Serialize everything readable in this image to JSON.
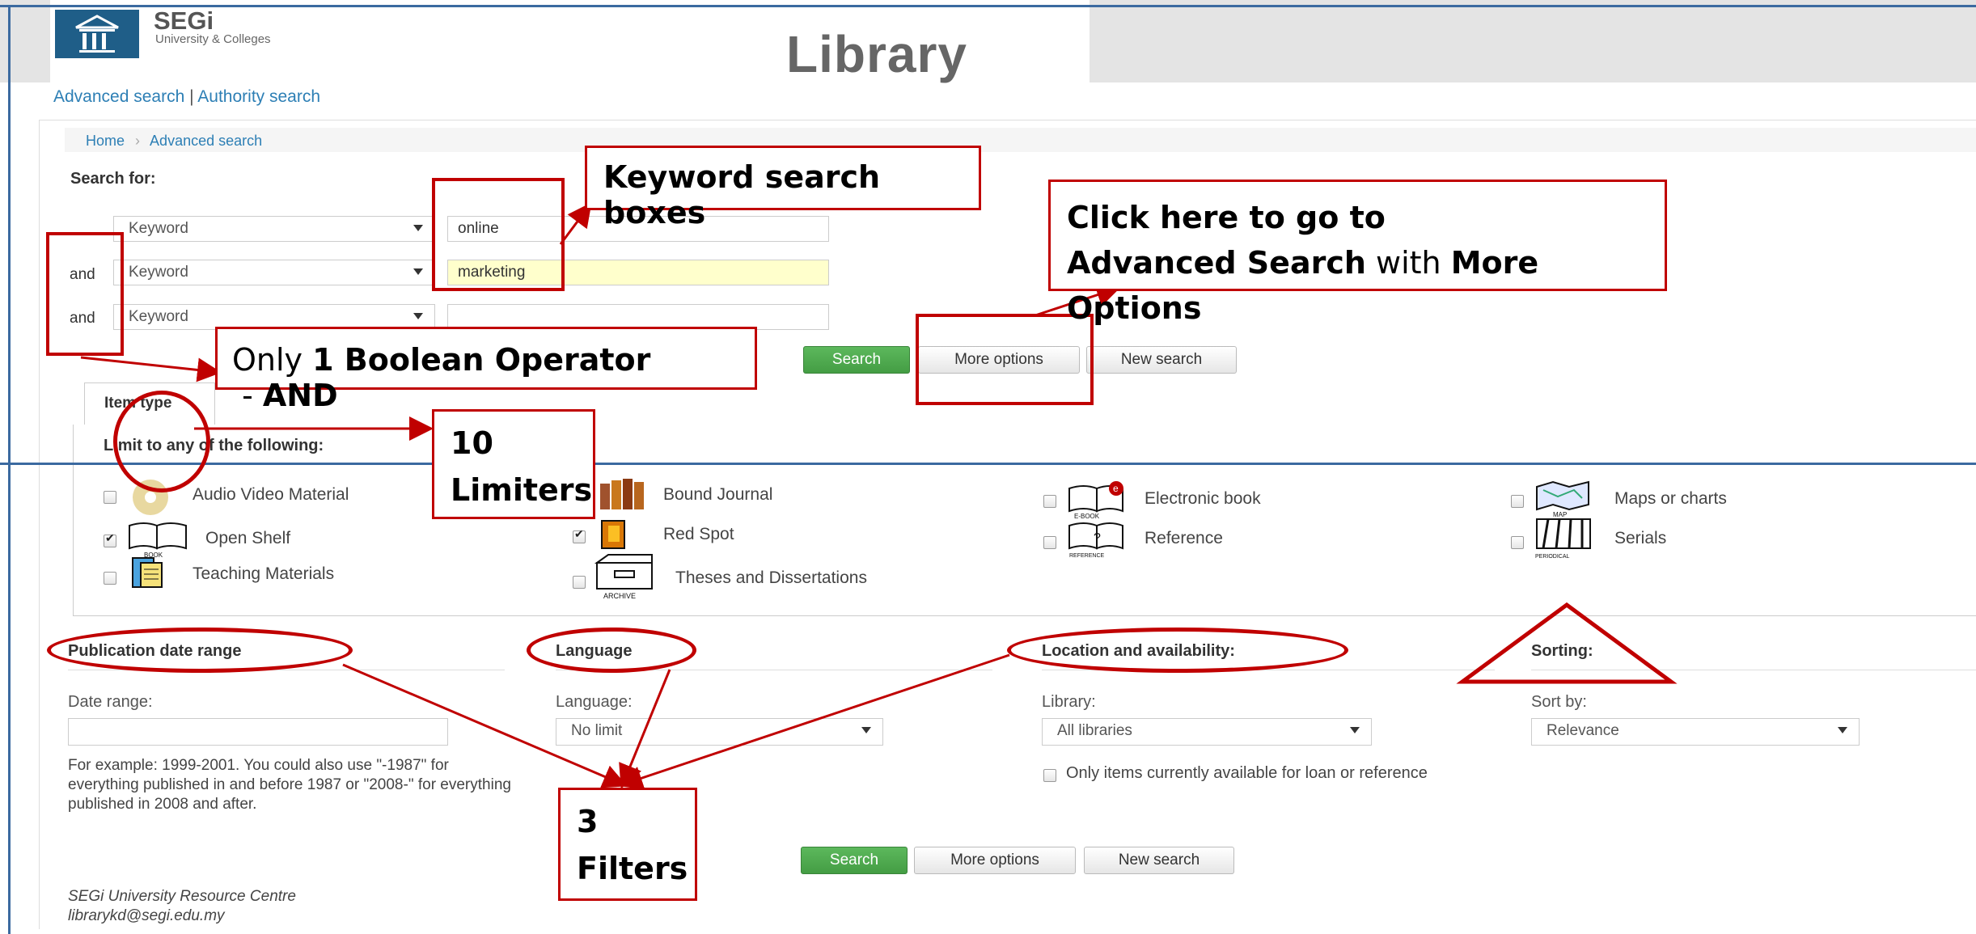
{
  "header": {
    "logo_brand": "SEGi",
    "logo_sub": "University & Colleges",
    "library_title": "Library"
  },
  "top_links": {
    "advanced_search": "Advanced search",
    "separator": "|",
    "authority_search": "Authority search"
  },
  "breadcrumb": {
    "home": "Home",
    "separator": "›",
    "current": "Advanced search"
  },
  "search": {
    "heading": "Search for:",
    "rows": [
      {
        "operator": "",
        "index": "Keyword",
        "value": "online"
      },
      {
        "operator": "and",
        "index": "Keyword",
        "value": "marketing"
      },
      {
        "operator": "and",
        "index": "Keyword",
        "value": ""
      }
    ],
    "buttons": {
      "search": "Search",
      "more_options": "More options",
      "new_search": "New search"
    }
  },
  "item_type": {
    "tab_label": "Item type",
    "limit_label": "Limit to any of the following:",
    "items": [
      {
        "label": "Audio Video Material",
        "checked": false,
        "icon": "audio-video-icon"
      },
      {
        "label": "Bound Journal",
        "checked": false,
        "icon": "bound-journal-icon"
      },
      {
        "label": "Electronic book",
        "checked": false,
        "icon": "ebook-icon",
        "caption": "E-BOOK"
      },
      {
        "label": "Maps or charts",
        "checked": false,
        "icon": "map-icon",
        "caption": "MAP"
      },
      {
        "label": "Open Shelf",
        "checked": true,
        "icon": "book-icon",
        "caption": "BOOK"
      },
      {
        "label": "Red Spot",
        "checked": true,
        "icon": "red-spot-icon"
      },
      {
        "label": "Reference",
        "checked": false,
        "icon": "reference-icon",
        "caption": "REFERENCE"
      },
      {
        "label": "Serials",
        "checked": false,
        "icon": "periodical-icon",
        "caption": "PERIODICAL"
      },
      {
        "label": "Teaching Materials",
        "checked": false,
        "icon": "teaching-materials-icon"
      },
      {
        "label": "Theses and Dissertations",
        "checked": false,
        "icon": "archive-icon",
        "caption": "ARCHIVE"
      }
    ]
  },
  "facets": {
    "pubdate": {
      "heading": "Publication date range",
      "sub": "Date range:",
      "value": "",
      "help": "For example: 1999-2001. You could also use \"-1987\" for everything published in and before 1987 or \"2008-\" for everything published in 2008 and after."
    },
    "language": {
      "heading": "Language",
      "sub": "Language:",
      "value": "No limit"
    },
    "location": {
      "heading": "Location and availability:",
      "sub": "Library:",
      "value": "All libraries",
      "checkbox_label": "Only items currently available for loan or reference"
    },
    "sorting": {
      "heading": "Sorting:",
      "sub": "Sort by:",
      "value": "Relevance"
    }
  },
  "footer": {
    "org": "SEGi University Resource Centre",
    "email": "librarykd@segi.edu.my"
  },
  "annotations": {
    "keyword_boxes": "Keyword search boxes",
    "advanced_line1": "Click here to go to",
    "advanced_line2_bold1": "Advanced Search",
    "advanced_line2_mid": " with ",
    "advanced_line2_bold2": "More Options",
    "boolean_pre": "Only ",
    "boolean_bold": "1 Boolean Operator",
    "boolean_mid": " - ",
    "boolean_bold2": "AND",
    "limiters_num": "10",
    "limiters_text": "Limiters",
    "filters_num": "3",
    "filters_text": "Filters",
    "color": "#c00000"
  }
}
